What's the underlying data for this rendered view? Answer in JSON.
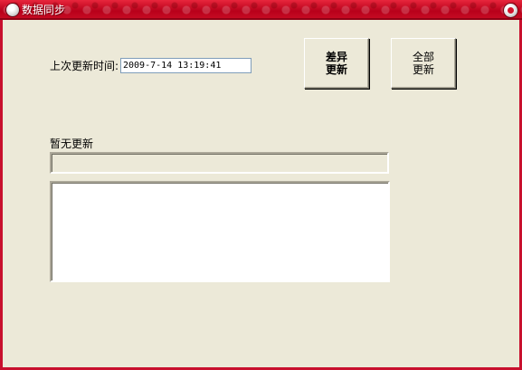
{
  "window": {
    "title": "数据同步"
  },
  "sync": {
    "last_update_label": "上次更新时间:",
    "last_update_value": "2009-7-14 13:19:41",
    "diff_update_label": "差异更新",
    "full_update_label": "全部更新",
    "status_text": "暂无更新",
    "progress": 0,
    "log_text": ""
  },
  "colors": {
    "titlebar": "#c8102e",
    "window_bg": "#ece9d8"
  }
}
